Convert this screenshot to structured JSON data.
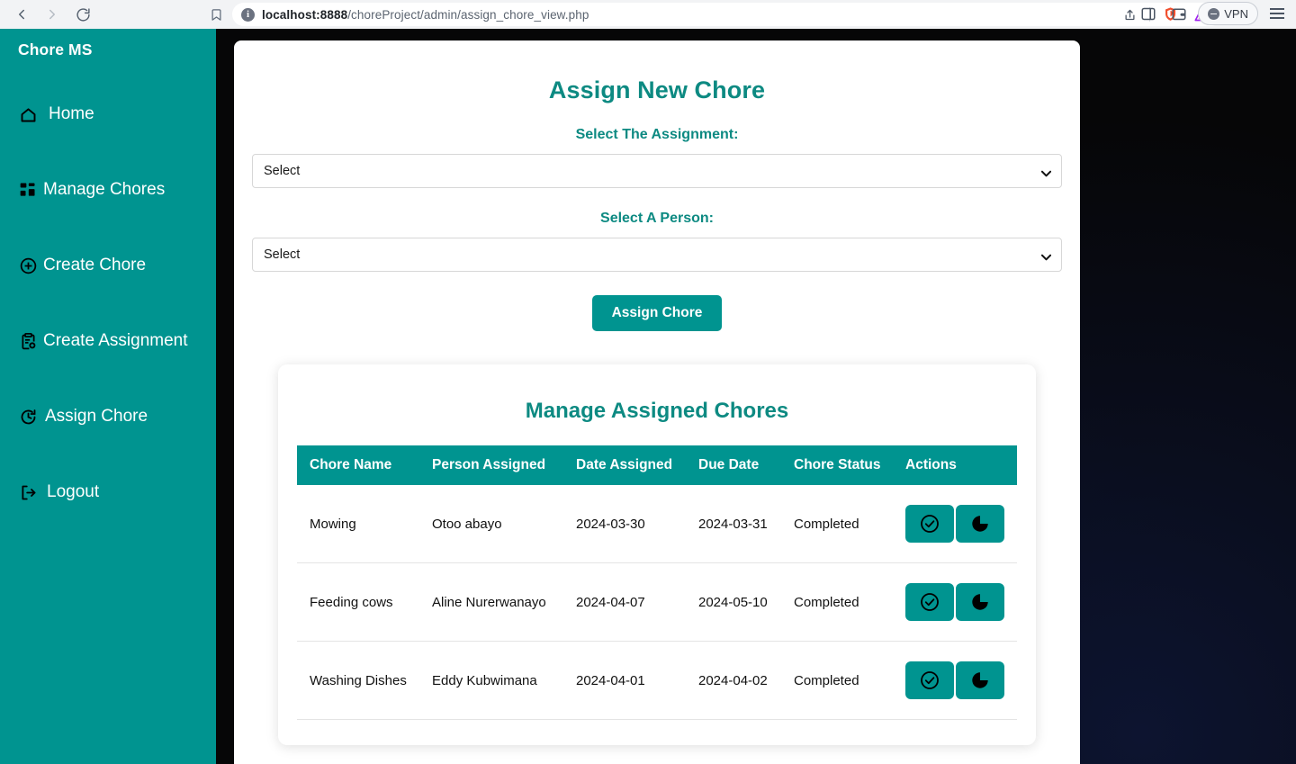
{
  "browser": {
    "back_label": "Back",
    "forward_label": "Forward",
    "reload_label": "Reload",
    "bookmark_label": "Bookmark",
    "url_host": "localhost:8888",
    "url_path": "/choreProject/admin/assign_chore_view.php",
    "share_label": "Share",
    "brave_shields_label": "Brave Shields",
    "brave_rewards_label": "Brave Rewards",
    "sidebar_toggle_label": "Toggle sidebar",
    "wallet_label": "Brave Wallet",
    "vpn_label": "VPN",
    "menu_label": "Customize and control Brave"
  },
  "sidebar": {
    "brand": "Chore MS",
    "items": [
      {
        "icon": "home-icon",
        "label": "Home"
      },
      {
        "icon": "grid-icon",
        "label": "Manage Chores"
      },
      {
        "icon": "plus-circle-icon",
        "label": "Create Chore"
      },
      {
        "icon": "clipboard-plus-icon",
        "label": "Create Assignment"
      },
      {
        "icon": "clock-rotate-icon",
        "label": "Assign Chore"
      },
      {
        "icon": "logout-icon",
        "label": "Logout"
      }
    ]
  },
  "main": {
    "title": "Assign New Chore",
    "assignment_label": "Select The Assignment:",
    "assignment_value": "Select",
    "person_label": "Select A Person:",
    "person_value": "Select",
    "submit_label": "Assign Chore"
  },
  "table_section": {
    "title": "Manage Assigned Chores",
    "columns": [
      "Chore Name",
      "Person Assigned",
      "Date Assigned",
      "Due Date",
      "Chore Status",
      "Actions"
    ],
    "rows": [
      {
        "chore": "Mowing",
        "person": "Otoo abayo",
        "date_assigned": "2024-03-30",
        "due_date": "2024-03-31",
        "status": "Completed",
        "action_complete": "check-circle-icon",
        "action_delete": "pie-chart-icon"
      },
      {
        "chore": "Feeding cows",
        "person": "Aline Nurerwanayo",
        "date_assigned": "2024-04-07",
        "due_date": "2024-05-10",
        "status": "Completed",
        "action_complete": "check-circle-icon",
        "action_delete": "pie-chart-icon"
      },
      {
        "chore": "Washing Dishes",
        "person": "Eddy Kubwimana",
        "date_assigned": "2024-04-01",
        "due_date": "2024-04-02",
        "status": "Completed",
        "action_complete": "check-circle-icon",
        "action_delete": "pie-chart-icon"
      }
    ]
  },
  "colors": {
    "teal": "#009490",
    "teal_text": "#0d8a82",
    "white": "#ffffff",
    "backdrop": "#060607"
  }
}
